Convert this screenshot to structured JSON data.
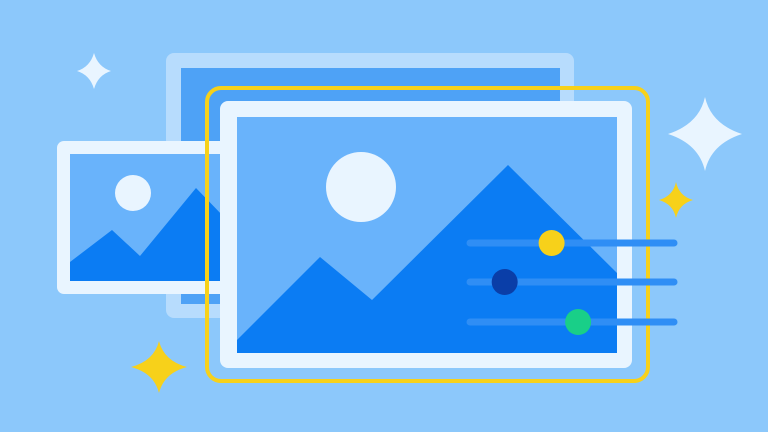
{
  "colors": {
    "background": "#8cc8fb",
    "frame_pale": "#e9f5ff",
    "frame_back": "#b7dcfd",
    "sky": "#69b3fb",
    "sky_back": "#4ea2f6",
    "mountain": "#0b7cf3",
    "sun": "#e9f5ff",
    "track": "#2f8ef5",
    "highlight": "#f7d11a",
    "knob_top": "#f7d11a",
    "knob_middle": "#0a3ea8",
    "knob_bottom": "#19cf88",
    "sparkle_white": "#e9f5ff",
    "sparkle_yellow": "#f7d11a"
  },
  "icons": {
    "main_image": "image-icon",
    "back_image": "image-icon",
    "small_image": "image-icon",
    "sliders": "sliders-icon",
    "sparkles": "sparkle-icon"
  },
  "sliders": [
    {
      "name": "top",
      "knob_color": "knob_top",
      "level": 0.4
    },
    {
      "name": "middle",
      "knob_color": "knob_middle",
      "level": 0.17
    },
    {
      "name": "bottom",
      "knob_color": "knob_bottom",
      "level": 0.53
    }
  ]
}
